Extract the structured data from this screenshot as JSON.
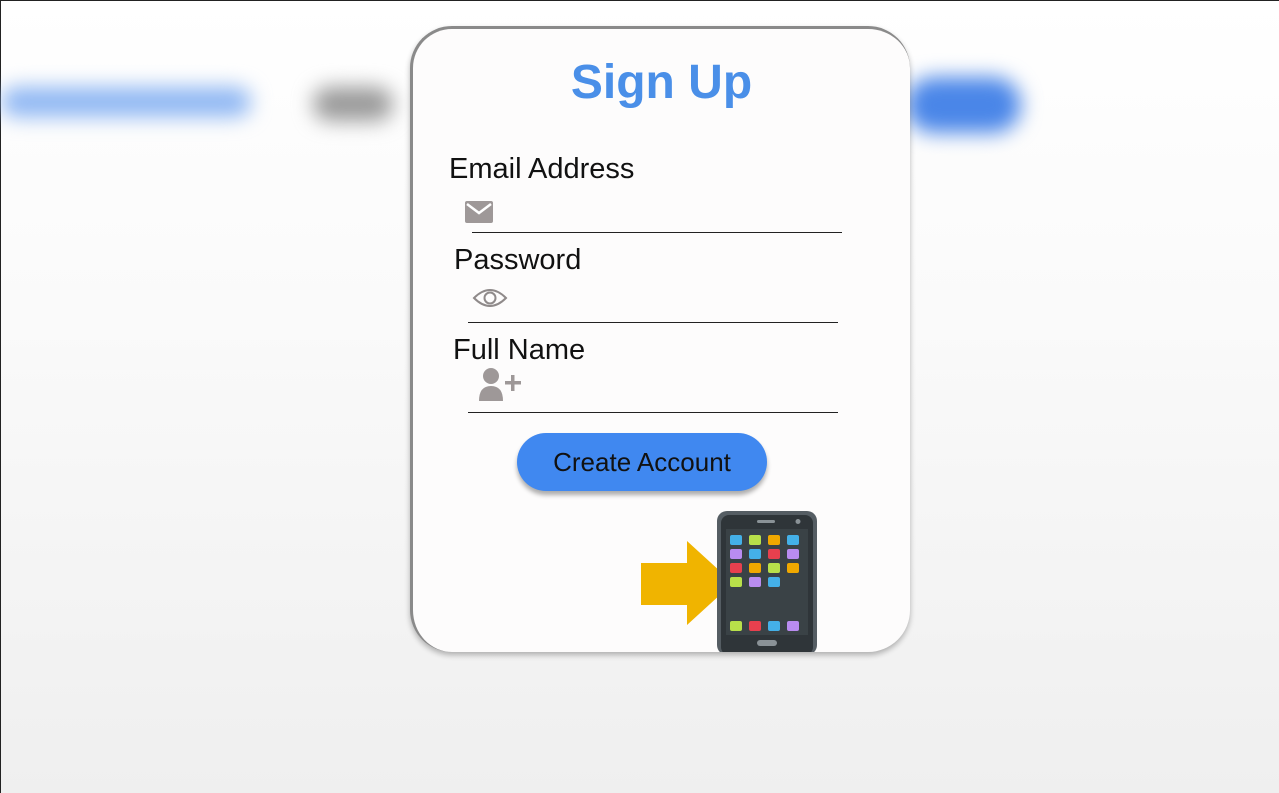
{
  "background": {
    "blurred_elements": [
      "blur-bar-left",
      "blur-button-grey",
      "blur-button-blue"
    ]
  },
  "form": {
    "title": "Sign Up",
    "title_color": "#4a8fe8",
    "fields": [
      {
        "label": "Email Address",
        "icon": "envelope-icon",
        "value": ""
      },
      {
        "label": "Password",
        "icon": "eye-icon",
        "value": ""
      },
      {
        "label": "Full Name",
        "icon": "add-user-icon",
        "value": ""
      }
    ],
    "submit_label": "Create Account",
    "button_color": "#4088f0",
    "illustration": [
      "arrow-right-icon",
      "smartphone-icon"
    ]
  }
}
